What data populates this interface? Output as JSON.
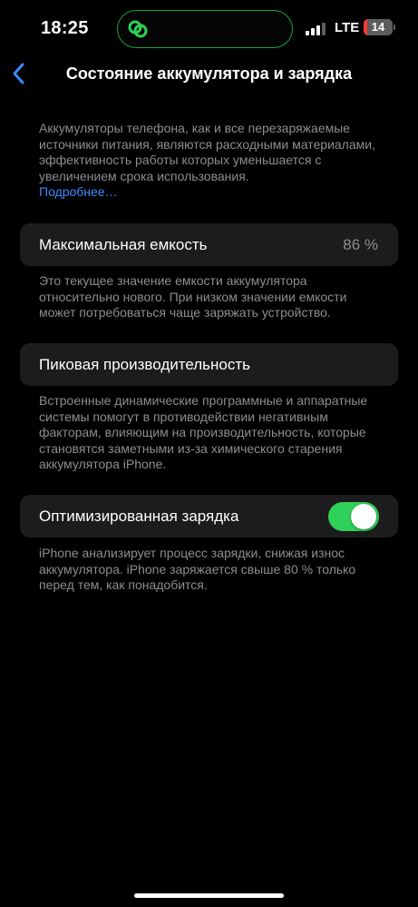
{
  "status_bar": {
    "time": "18:25",
    "network": "LTE",
    "battery_level": "14",
    "battery_fraction": 0.14,
    "signal_bars_active": 3,
    "signal_bars_total": 4,
    "island_icon": "link-chain-icon",
    "accent_color": "#30d158"
  },
  "header": {
    "back_icon": "chevron-left-icon",
    "title": "Состояние аккумулятора и зарядка"
  },
  "intro": {
    "text": "Аккумуляторы телефона, как и все перезаряжаемые источники питания, являются расходными материалами, эффективность работы которых уменьшается с увеличением срока использования.",
    "link": "Подробнее…"
  },
  "max_capacity": {
    "label": "Максимальная емкость",
    "value": "86 %",
    "description": "Это текущее значение емкости аккумулятора относительно нового. При низком значении емкости может потребоваться чаще заряжать устройство."
  },
  "peak_performance": {
    "label": "Пиковая производительность",
    "description": "Встроенные динамические программные и аппаратные системы помогут в противодействии негативным факторам, влияющим на производительность, которые становятся заметными из-за химического старения аккумулятора iPhone."
  },
  "optimized_charging": {
    "label": "Оптимизированная зарядка",
    "enabled": true,
    "description": "iPhone анализирует процесс зарядки, снижая износ аккумулятора. iPhone заряжается свыше 80 % только перед тем, как понадобится."
  }
}
